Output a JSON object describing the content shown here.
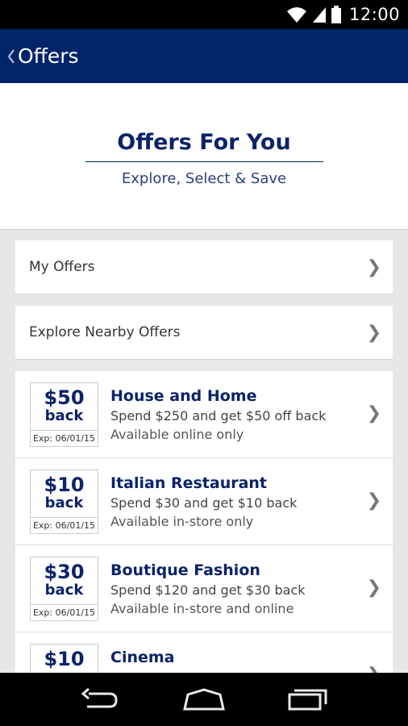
{
  "status": {
    "time": "12:00"
  },
  "appbar": {
    "title": "Offers"
  },
  "hero": {
    "title": "Offers For You",
    "subtitle": "Explore, Select & Save"
  },
  "links": [
    {
      "label": "My Offers"
    },
    {
      "label": "Explore Nearby Offers"
    }
  ],
  "offers": [
    {
      "amount": "$50",
      "back": "back",
      "exp": "Exp: 06/01/15",
      "name": "House and Home",
      "desc": "Spend $250 and get $50 off back",
      "avail": "Available online only"
    },
    {
      "amount": "$10",
      "back": "back",
      "exp": "Exp: 06/01/15",
      "name": "Italian Restaurant",
      "desc": "Spend $30 and get $10 back",
      "avail": "Available in-store only"
    },
    {
      "amount": "$30",
      "back": "back",
      "exp": "Exp: 06/01/15",
      "name": "Boutique Fashion",
      "desc": "Spend $120 and get $30 back",
      "avail": "Available in-store and online"
    },
    {
      "amount": "$10",
      "back": "",
      "exp": "",
      "name": "Cinema",
      "desc": "",
      "avail": ""
    }
  ],
  "colors": {
    "brand": "#002469",
    "accent_text": "#0c2369",
    "background": "#e6e7e9"
  },
  "icons": {
    "back": "chevron-left-icon",
    "row": "chevron-right-icon",
    "nav": [
      "nav-back-icon",
      "home-icon",
      "recents-icon"
    ]
  }
}
